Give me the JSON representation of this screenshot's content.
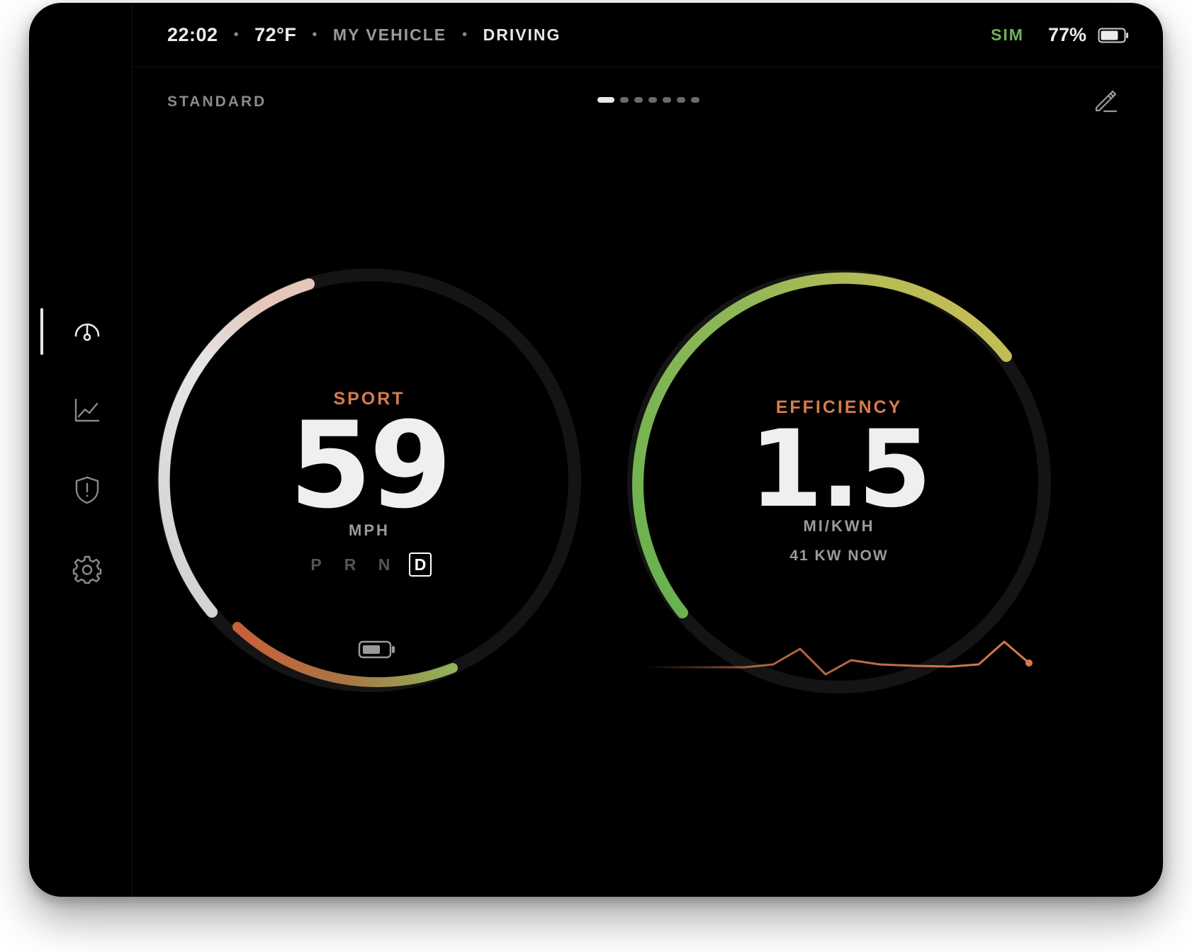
{
  "status_bar": {
    "time": "22:02",
    "temperature": "72°F",
    "vehicle": "MY VEHICLE",
    "state": "DRIVING",
    "sim": "SIM",
    "battery_percent": "77%",
    "battery_level": 0.77
  },
  "sidebar": {
    "items": [
      {
        "name": "gauge-icon",
        "active": true
      },
      {
        "name": "chart-icon",
        "active": false
      },
      {
        "name": "shield-alert-icon",
        "active": false
      },
      {
        "name": "gear-icon",
        "active": false
      }
    ]
  },
  "dashboard": {
    "layout_label": "STANDARD",
    "pages": 7,
    "active_page": 0,
    "edit_icon": "pencil-icon"
  },
  "speed_gauge": {
    "mode": "SPORT",
    "value": "59",
    "unit": "MPH",
    "gears": [
      "P",
      "R",
      "N",
      "D"
    ],
    "active_gear": "D"
  },
  "efficiency_gauge": {
    "label": "EFFICIENCY",
    "value": "1.5",
    "unit": "MI/KWH",
    "power": "41 KW NOW"
  },
  "colors": {
    "accent": "#d77b4e",
    "sim": "#6fb35a",
    "eff_start": "#66b14f",
    "eff_end": "#d6bf55",
    "regen_start": "#c9603a",
    "regen_end": "#8fb45a"
  }
}
